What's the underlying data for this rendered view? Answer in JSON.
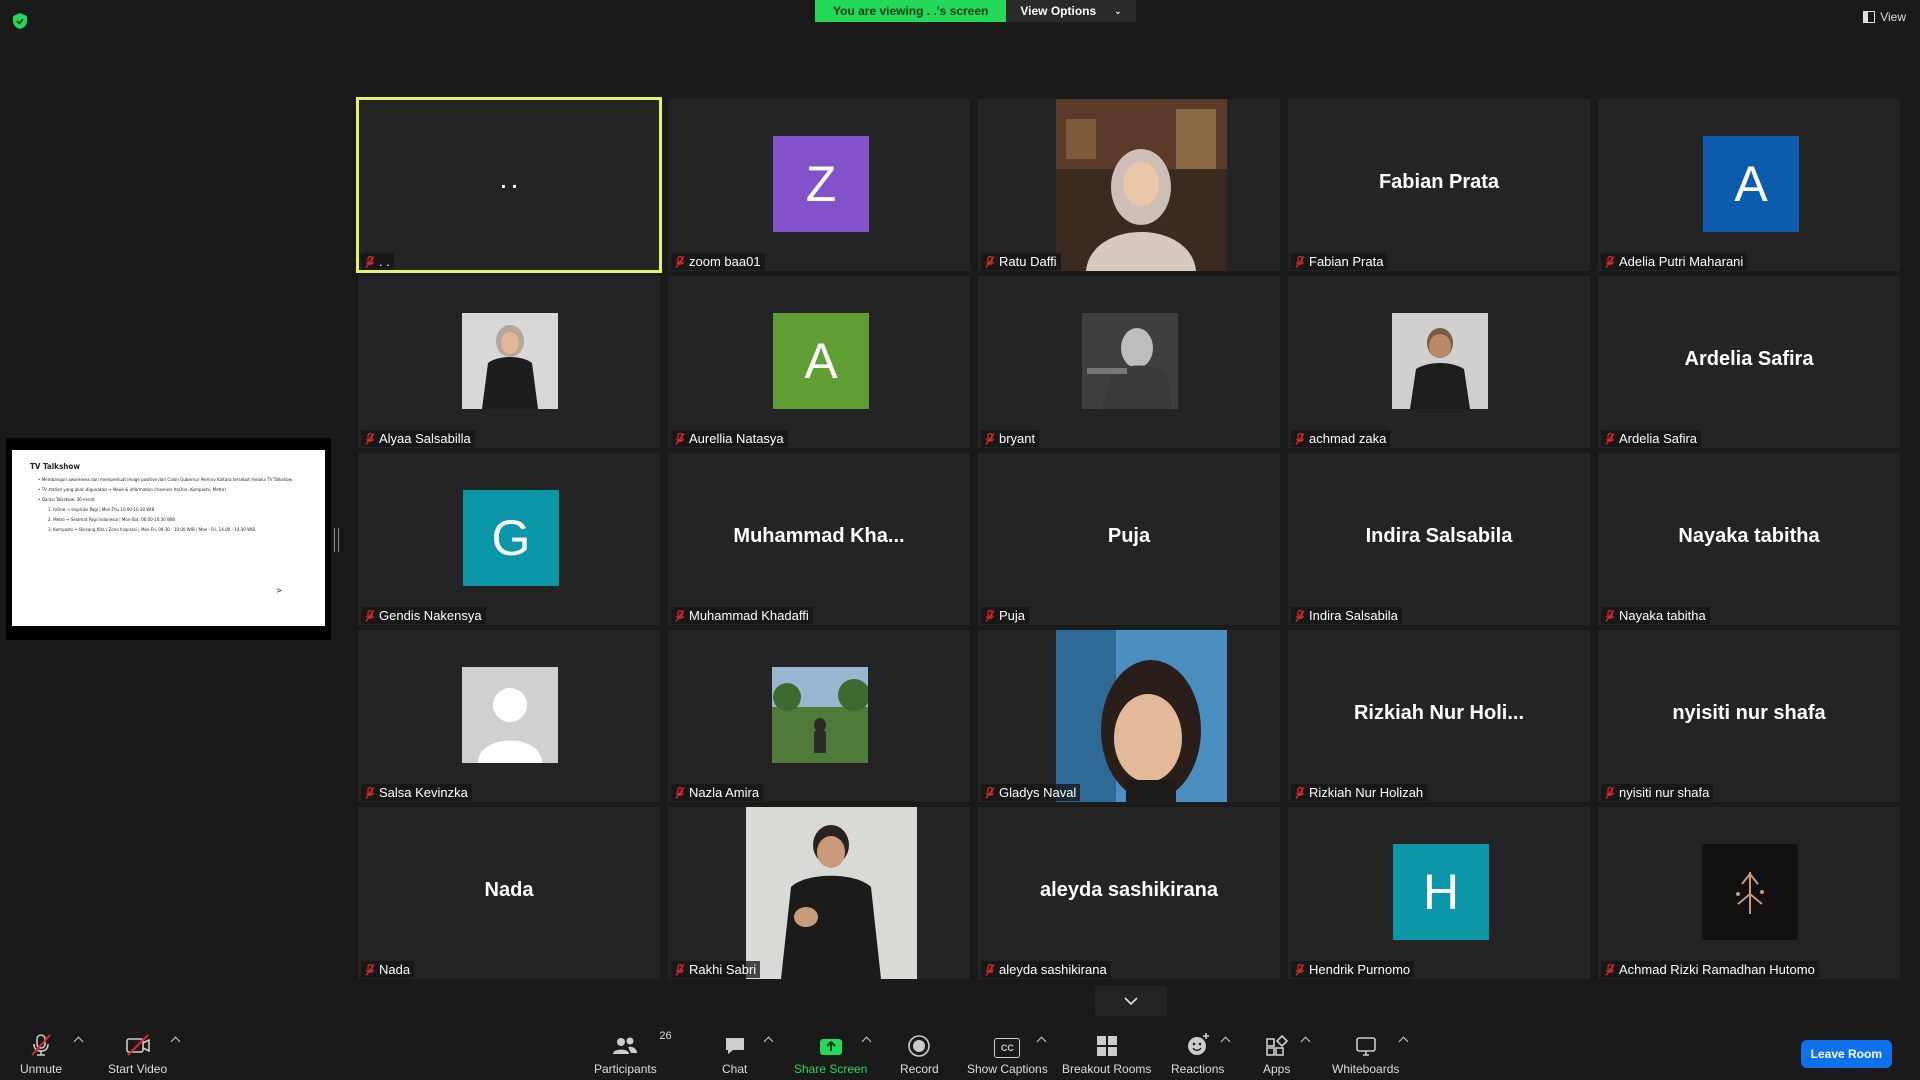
{
  "banner": {
    "viewing": "You are viewing . .'s screen",
    "options": "View Options"
  },
  "view_button": "View",
  "slide": {
    "title": "TV Talkshow",
    "bullets": [
      "Membangun awareness dan memperkuat image positive dari Calon Gubernur Pemrov Kaltara tersebut melalui TV Talkshow.",
      "TV station yang akan digunakan → News & information channels (tvOne, Kompastv, Metro)",
      "Durasi Talkshow: 30 menit"
    ],
    "sub_items": [
      "1. tvOne → Inspirasi Pagi | Mon-Thu 10.00-10.30 WIB",
      "2. Metro → Selamat Pagi Indonesia | Mon-Sat, 06.00-10.30 WIB",
      "3. Kompastv → Bincang Kita / Zona Inspirasi | Mon-Fri, 09.30 - 10.00 WIB / Mon - Fri, 14.00 - 14.30 WIB"
    ],
    "arrow": ">"
  },
  "tiles": [
    {
      "label": ". .",
      "big": ". .",
      "type": "name",
      "active": true
    },
    {
      "label": "zoom baa01",
      "type": "avatar",
      "letter": "Z",
      "color": "#8352c8"
    },
    {
      "label": "Ratu Daffi",
      "type": "photo",
      "photo": "ratu"
    },
    {
      "label": "Fabian Prata",
      "big": "Fabian Prata",
      "type": "name"
    },
    {
      "label": "Adelia Putri Maharani",
      "type": "avatar",
      "letter": "A",
      "color": "#0b5cad"
    },
    {
      "label": "Alyaa Salsabilla",
      "type": "photo-sm",
      "photo": "alyaa"
    },
    {
      "label": "Aurellia Natasya",
      "type": "avatar",
      "letter": "A",
      "color": "#5f9e33"
    },
    {
      "label": "bryant",
      "type": "photo-sm",
      "photo": "bryant"
    },
    {
      "label": "achmad zaka",
      "type": "photo-sm",
      "photo": "zaka"
    },
    {
      "label": "Ardelia Safira",
      "big": "Ardelia Safira",
      "type": "name"
    },
    {
      "label": "Gendis Nakensya",
      "type": "avatar",
      "letter": "G",
      "color": "#0b97a8"
    },
    {
      "label": "Muhammad Khadaffi",
      "big": "Muhammad  Kha...",
      "type": "name"
    },
    {
      "label": "Puja",
      "big": "Puja",
      "type": "name"
    },
    {
      "label": "Indira Salsabila",
      "big": "Indira Salsabila",
      "type": "name"
    },
    {
      "label": "Nayaka tabitha",
      "big": "Nayaka tabitha",
      "type": "name"
    },
    {
      "label": "Salsa Kevinzka",
      "type": "photo-sm",
      "photo": "default"
    },
    {
      "label": "Nazla Amira",
      "type": "photo-sm",
      "photo": "nazla"
    },
    {
      "label": "Gladys Naval",
      "type": "photo",
      "photo": "gladys"
    },
    {
      "label": "Rizkiah Nur Holizah",
      "big": "Rizkiah  Nur  Holi...",
      "type": "name"
    },
    {
      "label": "nyisiti nur shafa",
      "big": "nyisiti nur shafa",
      "type": "name"
    },
    {
      "label": "Nada",
      "big": "Nada",
      "type": "name"
    },
    {
      "label": "Rakhi Sabri",
      "type": "photo",
      "photo": "rakhi"
    },
    {
      "label": "aleyda sashikirana",
      "big": "aleyda sashikirana",
      "type": "name"
    },
    {
      "label": "Hendrik Purnomo",
      "type": "avatar",
      "letter": "H",
      "color": "#0b97a8"
    },
    {
      "label": "Achmad Rizki Ramadhan Hutomo",
      "type": "photo-sm",
      "photo": "logo"
    }
  ],
  "toolbar": {
    "unmute": "Unmute",
    "start_video": "Start Video",
    "participants": "Participants",
    "participant_count": "26",
    "chat": "Chat",
    "share_screen": "Share Screen",
    "record": "Record",
    "show_captions": "Show Captions",
    "cc": "CC",
    "breakout_rooms": "Breakout Rooms",
    "reactions": "Reactions",
    "apps": "Apps",
    "whiteboards": "Whiteboards",
    "leave_room": "Leave Room"
  }
}
